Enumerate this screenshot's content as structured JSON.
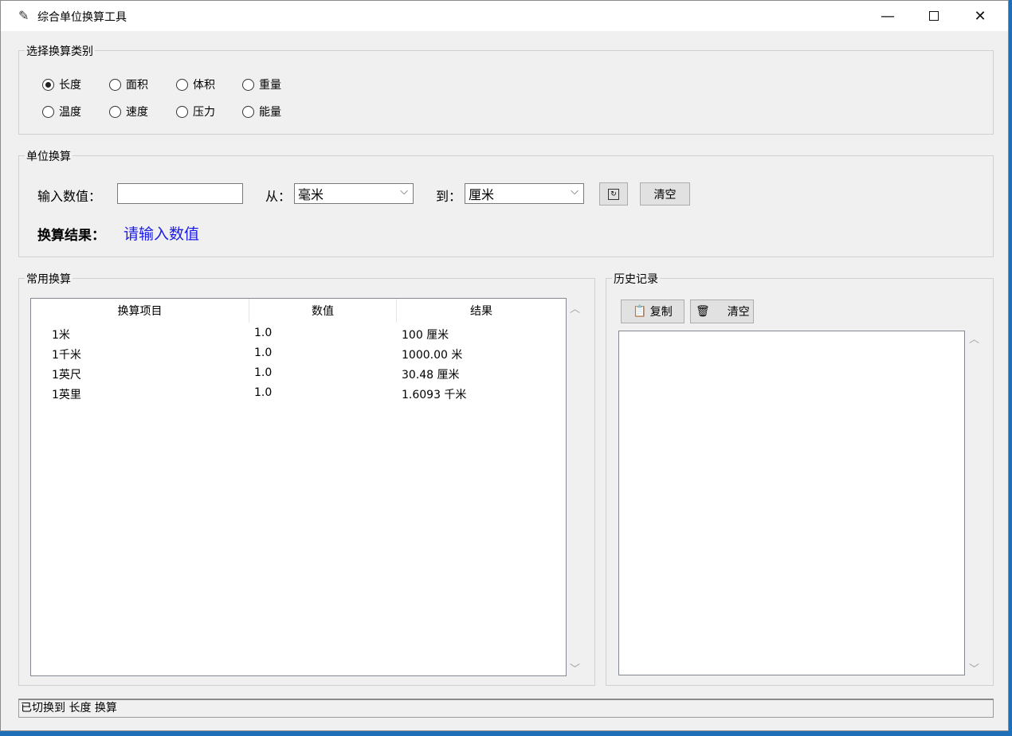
{
  "window": {
    "title": "综合单位换算工具",
    "title_icon": "feather-icon"
  },
  "category_group": {
    "label": "选择换算类别",
    "options": [
      "长度",
      "面积",
      "体积",
      "重量",
      "温度",
      "速度",
      "压力",
      "能量"
    ],
    "selected": "长度"
  },
  "convert_group": {
    "label": "单位换算",
    "input_label": "输入数值：",
    "input_value": "",
    "from_label": "从：",
    "from_value": "毫米",
    "to_label": "到：",
    "to_value": "厘米",
    "swap_icon": "swap-icon",
    "clear_label": "清空",
    "result_label": "换算结果：",
    "result_value": "请输入数值"
  },
  "common_group": {
    "label": "常用换算",
    "columns": [
      "换算项目",
      "数值",
      "结果"
    ],
    "rows": [
      [
        "1米",
        "1.0",
        "100 厘米"
      ],
      [
        "1千米",
        "1.0",
        "1000.00 米"
      ],
      [
        "1英尺",
        "1.0",
        "30.48 厘米"
      ],
      [
        "1英里",
        "1.0",
        "1.6093 千米"
      ]
    ]
  },
  "history_group": {
    "label": "历史记录",
    "copy_label": "复制",
    "copy_icon": "clipboard-icon",
    "clear_label": "清空",
    "clear_icon": "trash-icon"
  },
  "status": {
    "text": "已切换到 长度 换算"
  }
}
